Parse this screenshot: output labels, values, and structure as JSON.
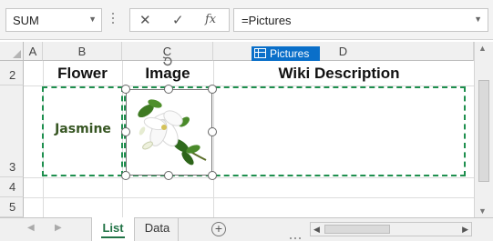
{
  "formula_bar": {
    "name_box": "SUM",
    "cancel_glyph": "✕",
    "enter_glyph": "✓",
    "function_glyph": "fx",
    "formula": "=Pictures"
  },
  "columns": [
    "A",
    "B",
    "C",
    "D"
  ],
  "rows": [
    "2",
    "3",
    "4",
    "5"
  ],
  "headers": {
    "flower": "Flower",
    "image": "Image",
    "wiki": "Wiki Description"
  },
  "cells": {
    "b3": "Jasmine"
  },
  "tooltip": {
    "label": "Pictures"
  },
  "sheet_tabs": [
    "List",
    "Data"
  ],
  "active_tab": "List",
  "colors": {
    "accent": "#217346",
    "marquee": "#1e8f4e",
    "tooltip_bg": "#0a6fc9",
    "jasmine_text": "#375623"
  }
}
